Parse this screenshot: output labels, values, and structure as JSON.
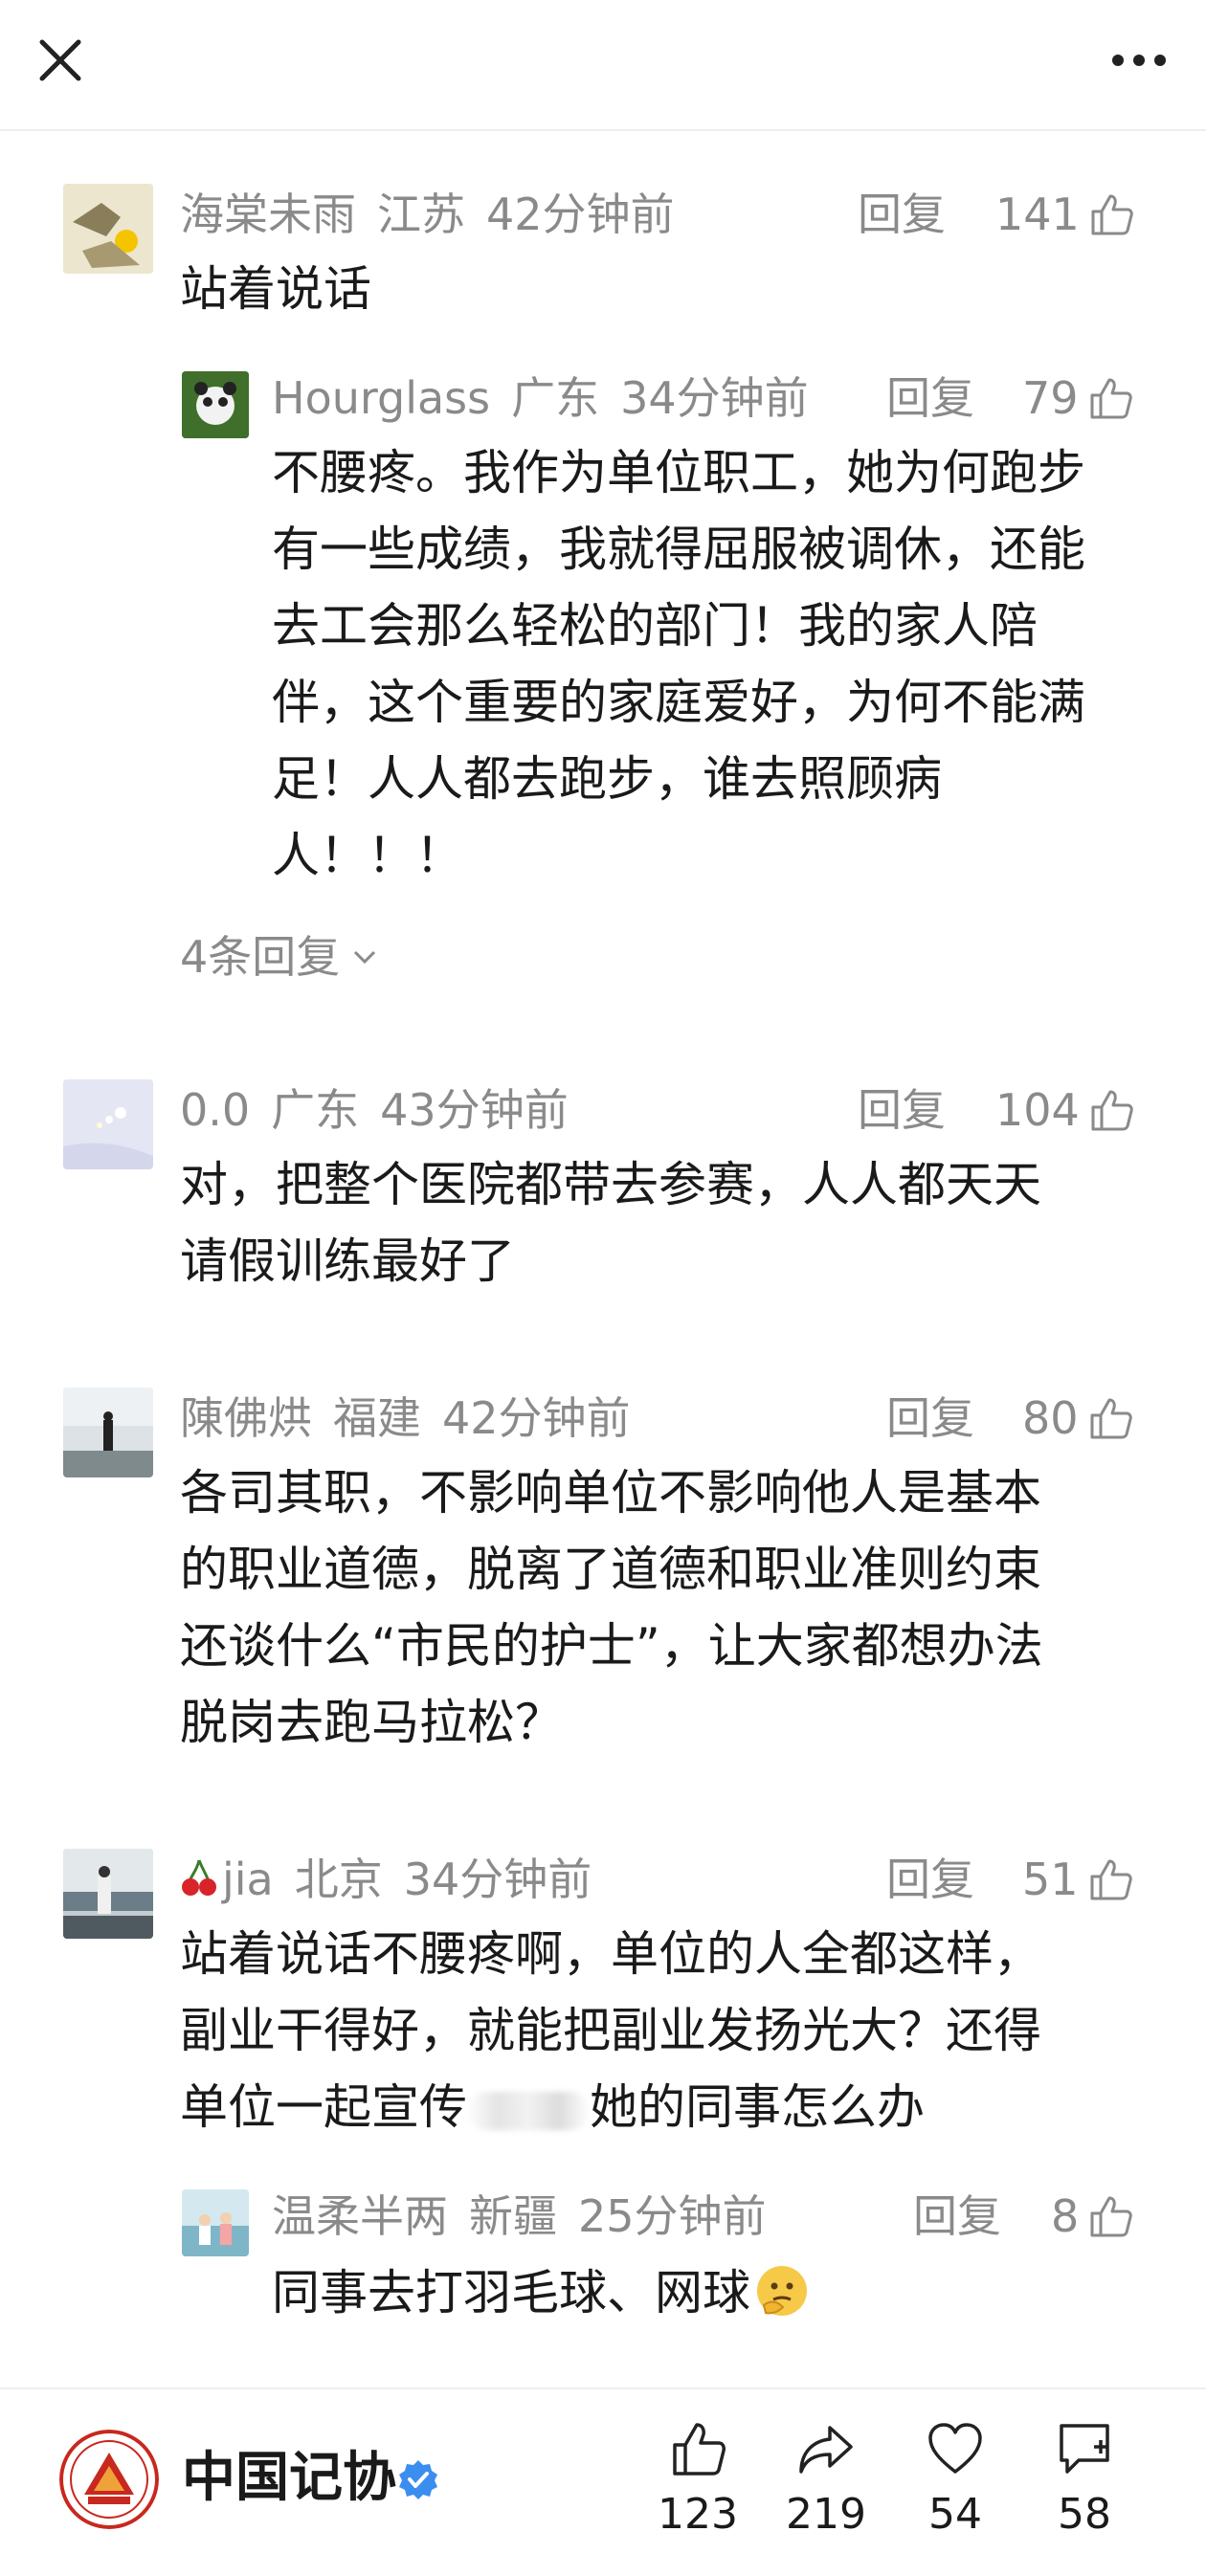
{
  "comments": [
    {
      "user": "海棠未雨",
      "region": "江苏",
      "time": "42分钟前",
      "reply_label": "回复",
      "likes": "141",
      "text": "站着说话",
      "replies": [
        {
          "user": "Hourglass",
          "region": "广东",
          "time": "34分钟前",
          "reply_label": "回复",
          "likes": "79",
          "lines": [
            "不腰疼。我作为单位职工，她为何跑步",
            "有一些成绩，我就得屈服被调休，还能",
            "去工会那么轻松的部门！我的家人陪",
            "伴，这个重要的家庭爱好，为何不能满",
            "足！人人都去跑步，谁去照顾病",
            "人！！！"
          ]
        }
      ],
      "expand_label": "4条回复"
    },
    {
      "user": "0.0",
      "region": "广东",
      "time": "43分钟前",
      "reply_label": "回复",
      "likes": "104",
      "lines": [
        "对，把整个医院都带去参赛，人人都天天",
        "请假训练最好了"
      ]
    },
    {
      "user": "陳佛烘",
      "region": "福建",
      "time": "42分钟前",
      "reply_label": "回复",
      "likes": "80",
      "lines": [
        "各司其职，不影响单位不影响他人是基本",
        "的职业道德，脱离了道德和职业准则约束",
        "还谈什么“市民的护士”，让大家都想办法",
        "脱岗去跑马拉松？"
      ]
    },
    {
      "user": "jia",
      "user_emoji": "cherry-icon",
      "region": "北京",
      "time": "34分钟前",
      "reply_label": "回复",
      "likes": "51",
      "lines": [
        "站着说话不腰疼啊，单位的人全都这样，",
        "副业干得好，就能把副业发扬光大？还得"
      ],
      "line3_before": "单位一起宣传",
      "line3_after": "她的同事怎么办",
      "replies": [
        {
          "user": "温柔半两",
          "region": "新疆",
          "time": "25分钟前",
          "reply_label": "回复",
          "likes": "8",
          "text": "同事去打羽毛球、网球",
          "text_emoji": "thinking-face-icon"
        }
      ]
    }
  ],
  "bottom_bar": {
    "account_name": "中国记协",
    "verified_icon": "verified-badge-icon",
    "actions": [
      {
        "icon": "thumbs-up-icon",
        "count": "123"
      },
      {
        "icon": "share-icon",
        "count": "219"
      },
      {
        "icon": "heart-icon",
        "count": "54"
      },
      {
        "icon": "comment-add-icon",
        "count": "58"
      }
    ]
  },
  "colors": {
    "meta_gray": "#8a8a8a",
    "text_dark": "#1a1a1a",
    "verified_blue": "#3b8ef0",
    "logo_red": "#c8281e"
  }
}
